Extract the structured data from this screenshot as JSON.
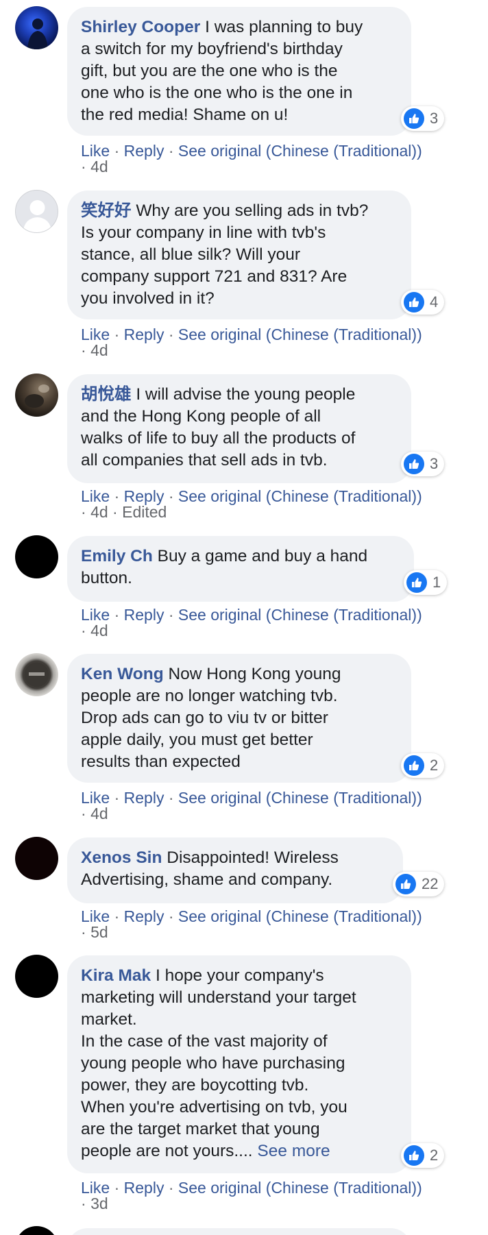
{
  "actions": {
    "like": "Like",
    "reply": "Reply",
    "see_original": "See original (Chinese (Traditional))"
  },
  "comments": [
    {
      "author": "Shirley Cooper",
      "lines": [
        "I was planning to buy",
        "a switch for my boyfriend's birthday",
        "gift, but you are the one who is the",
        "one who is the one who is the one in",
        "the red media! Shame on u!"
      ],
      "likes": "3",
      "time": "4d",
      "edited": ""
    },
    {
      "author": "笑好好",
      "lines": [
        "Why are you selling ads in tvb?",
        "Is your company in line with tvb's",
        "stance, all blue silk? Will your",
        "company support 721 and 831? Are",
        "you involved in it?"
      ],
      "likes": "4",
      "time": "4d",
      "edited": ""
    },
    {
      "author": "胡悅雄",
      "lines": [
        "I will advise the young people",
        "and the Hong Kong people of all",
        "walks of life to buy all the products of",
        "all companies that sell ads in tvb."
      ],
      "likes": "3",
      "time": "4d",
      "edited": "Edited"
    },
    {
      "author": "Emily Ch",
      "lines": [
        "Buy a game and buy a hand",
        "button."
      ],
      "likes": "1",
      "time": "4d",
      "edited": ""
    },
    {
      "author": "Ken Wong",
      "lines": [
        "Now Hong Kong young",
        "people are no longer watching tvb.",
        "Drop ads can go to viu tv or bitter",
        "apple daily, you must get better",
        "results than expected"
      ],
      "likes": "2",
      "time": "4d",
      "edited": ""
    },
    {
      "author": "Xenos Sin",
      "lines": [
        "Disappointed! Wireless",
        "Advertising, shame and company."
      ],
      "likes": "22",
      "time": "5d",
      "edited": ""
    },
    {
      "author": "Kira Mak",
      "lines": [
        "I hope your company's",
        "marketing will understand your target",
        "market.",
        "In the case of the vast majority of",
        "young people who have purchasing",
        "power, they are boycotting tvb.",
        "When you're advertising on tvb, you",
        "are the target market that young",
        "people are not yours...."
      ],
      "see_more": "See more",
      "likes": "2",
      "time": "3d",
      "edited": ""
    }
  ],
  "colors": {
    "link": "#385898",
    "bubble": "#f0f2f5",
    "like_blue": "#1877f2",
    "muted": "#65676b"
  }
}
